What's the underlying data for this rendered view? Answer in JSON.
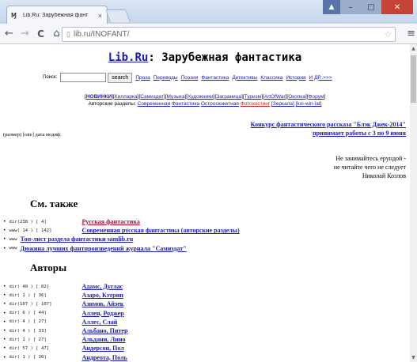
{
  "browser": {
    "tab_title": "Lib.Ru: Зарубежная фант",
    "tab_favicon": "Ɱ",
    "tab_close": "×",
    "url": "lib.ru/INOFANT/",
    "back": "←",
    "forward": "→",
    "reload": "C",
    "home": "⌂",
    "page_icon": "▯",
    "star": "☆",
    "menu": "≡",
    "win": {
      "user": "▲",
      "min": "–",
      "max": "□",
      "close": "✕"
    }
  },
  "page": {
    "site_name": "Lib.Ru",
    "title_rest": ": Зарубежная фантастика",
    "search": {
      "label": "Поиск:",
      "placeholder": "",
      "button": "search"
    },
    "nav_links": [
      "Проза",
      "Переводы",
      "Поэзия",
      "Фантастика",
      "Детективы",
      "Классика",
      "История",
      "И ДР..>>>"
    ],
    "brackets_row1": [
      {
        "text": "НОВИНКИ",
        "bold": true
      },
      {
        "text": "Килларка"
      },
      {
        "text": "Самиздат"
      },
      {
        "text": "Музыка"
      },
      {
        "text": "Художники"
      },
      {
        "text": "Заграница"
      },
      {
        "text": "Туризм"
      },
      {
        "text": "ArtOfWar"
      },
      {
        "text": "Окопка"
      },
      {
        "text": "Форум"
      }
    ],
    "brackets_row2": {
      "label": "Авторские разделы:",
      "links": [
        {
          "text": "Современная"
        },
        {
          "text": "Фантастика"
        },
        {
          "text": "Остросюжетная"
        },
        {
          "text": "Фотохостинг",
          "red": true
        },
        {
          "text": "[Зеркала]"
        },
        {
          "text": "[koi-win-lat]"
        }
      ]
    },
    "legend": "(размер) [rate] дата модиф.",
    "contest": {
      "line1": "Конкурс фантастического рассказа \"Блэк Джек-2014\"",
      "line2": "принимает работы с 3 по 9 июня"
    },
    "quote": {
      "line1": "Не занимайтесь ерундой -",
      "line2": "не читайте чего не следует",
      "author": "Николай Козлов"
    },
    "see_also_heading": "См. также",
    "see_also": [
      {
        "code": "dir(238 ) [   4]",
        "title": "Русская фантастика",
        "red": true
      },
      {
        "code": "www( 14 ) [ 142]",
        "title": "Современная русская фантастика (авторские разделы)"
      },
      {
        "code": "www",
        "title": "Топ-лист раздела фантастики samlib.ru"
      },
      {
        "code": "www",
        "title": "Дюжина лучших фантпроизведений журнала \"Самиздат\""
      }
    ],
    "authors_heading": "Авторы",
    "authors": [
      {
        "code": "dir( 40 ) [  82]",
        "name": "Адамс, Дуглас"
      },
      {
        "code": "dir(  1 ) [  36]",
        "name": "Азаро, Кэтрин"
      },
      {
        "code": "dir(107 ) [ 107]",
        "name": "Азимов, Айзек"
      },
      {
        "code": "dir(  6 ) [  44]",
        "name": "Аллен, Роджер"
      },
      {
        "code": "dir(  4 ) [  27]",
        "name": "Аллес, Слай"
      },
      {
        "code": "dir(  4 ) [  33]",
        "name": "Альбано, Питер"
      },
      {
        "code": "dir(  1 ) [  27]",
        "name": "Альдани, Лино"
      },
      {
        "code": "dir( 57 ) [  47]",
        "name": "Андерсон, Пол"
      },
      {
        "code": "dir(  1 ) [  30]",
        "name": "Андреота, Поль"
      }
    ]
  }
}
